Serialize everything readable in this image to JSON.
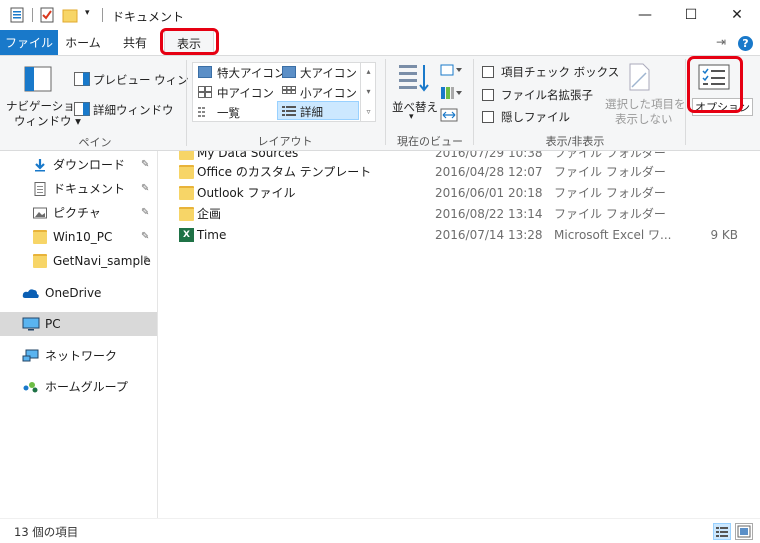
{
  "window": {
    "title": "ドキュメント",
    "minimize_glyph": "—",
    "maximize_glyph": "☐",
    "close_glyph": "✕"
  },
  "tabs": [
    {
      "label": "ファイル"
    },
    {
      "label": "ホーム"
    },
    {
      "label": "共有"
    },
    {
      "label": "表示"
    }
  ],
  "ribbon": {
    "pane": {
      "nav_pane_label_1": "ナビゲーション",
      "nav_pane_label_2": "ウィンドウ ▾",
      "preview_label": "プレビュー ウィンドウ",
      "details_label": "詳細ウィンドウ",
      "group_label": "ペイン"
    },
    "layout": {
      "items": [
        "特大アイコン",
        "大アイコン",
        "中アイコン",
        "小アイコン",
        "一覧",
        "詳細"
      ],
      "group_label": "レイアウト"
    },
    "current_view": {
      "sort_label_1": "並べ替え",
      "sort_label_2": "▾",
      "group_label": "現在のビュー"
    },
    "show_hide": {
      "item_checkbox": "項目チェック ボックス",
      "file_ext": "ファイル名拡張子",
      "hidden_files": "隠しファイル",
      "hide_selected_1": "選択した項目を",
      "hide_selected_2": "表示しない",
      "group_label": "表示/非表示"
    },
    "options_label": "オプション",
    "pin_glyph": "⇥",
    "help_glyph": "?"
  },
  "nav": {
    "items": [
      {
        "label": "ダウンロード",
        "pinned": true
      },
      {
        "label": "ドキュメント",
        "pinned": true
      },
      {
        "label": "ピクチャ",
        "pinned": true
      },
      {
        "label": "Win10_PC",
        "pinned": true
      },
      {
        "label": "GetNavi_sample",
        "pinned": true
      },
      {
        "label": "OneDrive"
      },
      {
        "label": "PC"
      },
      {
        "label": "ネットワーク"
      },
      {
        "label": "ホームグループ"
      }
    ],
    "pin_glyph": "📌"
  },
  "files": [
    {
      "name": "My Data Sources",
      "date": "2016/07/29 10:38",
      "type": "ファイル フォルダー",
      "size": ""
    },
    {
      "name": "Office のカスタム テンプレート",
      "date": "2016/04/28 12:07",
      "type": "ファイル フォルダー",
      "size": ""
    },
    {
      "name": "Outlook ファイル",
      "date": "2016/06/01 20:18",
      "type": "ファイル フォルダー",
      "size": ""
    },
    {
      "name": "企画",
      "date": "2016/08/22 13:14",
      "type": "ファイル フォルダー",
      "size": ""
    },
    {
      "name": "Time",
      "date": "2016/07/14 13:28",
      "type": "Microsoft Excel ワ...",
      "size": "9 KB"
    }
  ],
  "status": {
    "count": "13 個の項目"
  },
  "colors": {
    "file_tab": "#1979ca",
    "highlight": "#e60012",
    "selection": "#cce8ff"
  }
}
